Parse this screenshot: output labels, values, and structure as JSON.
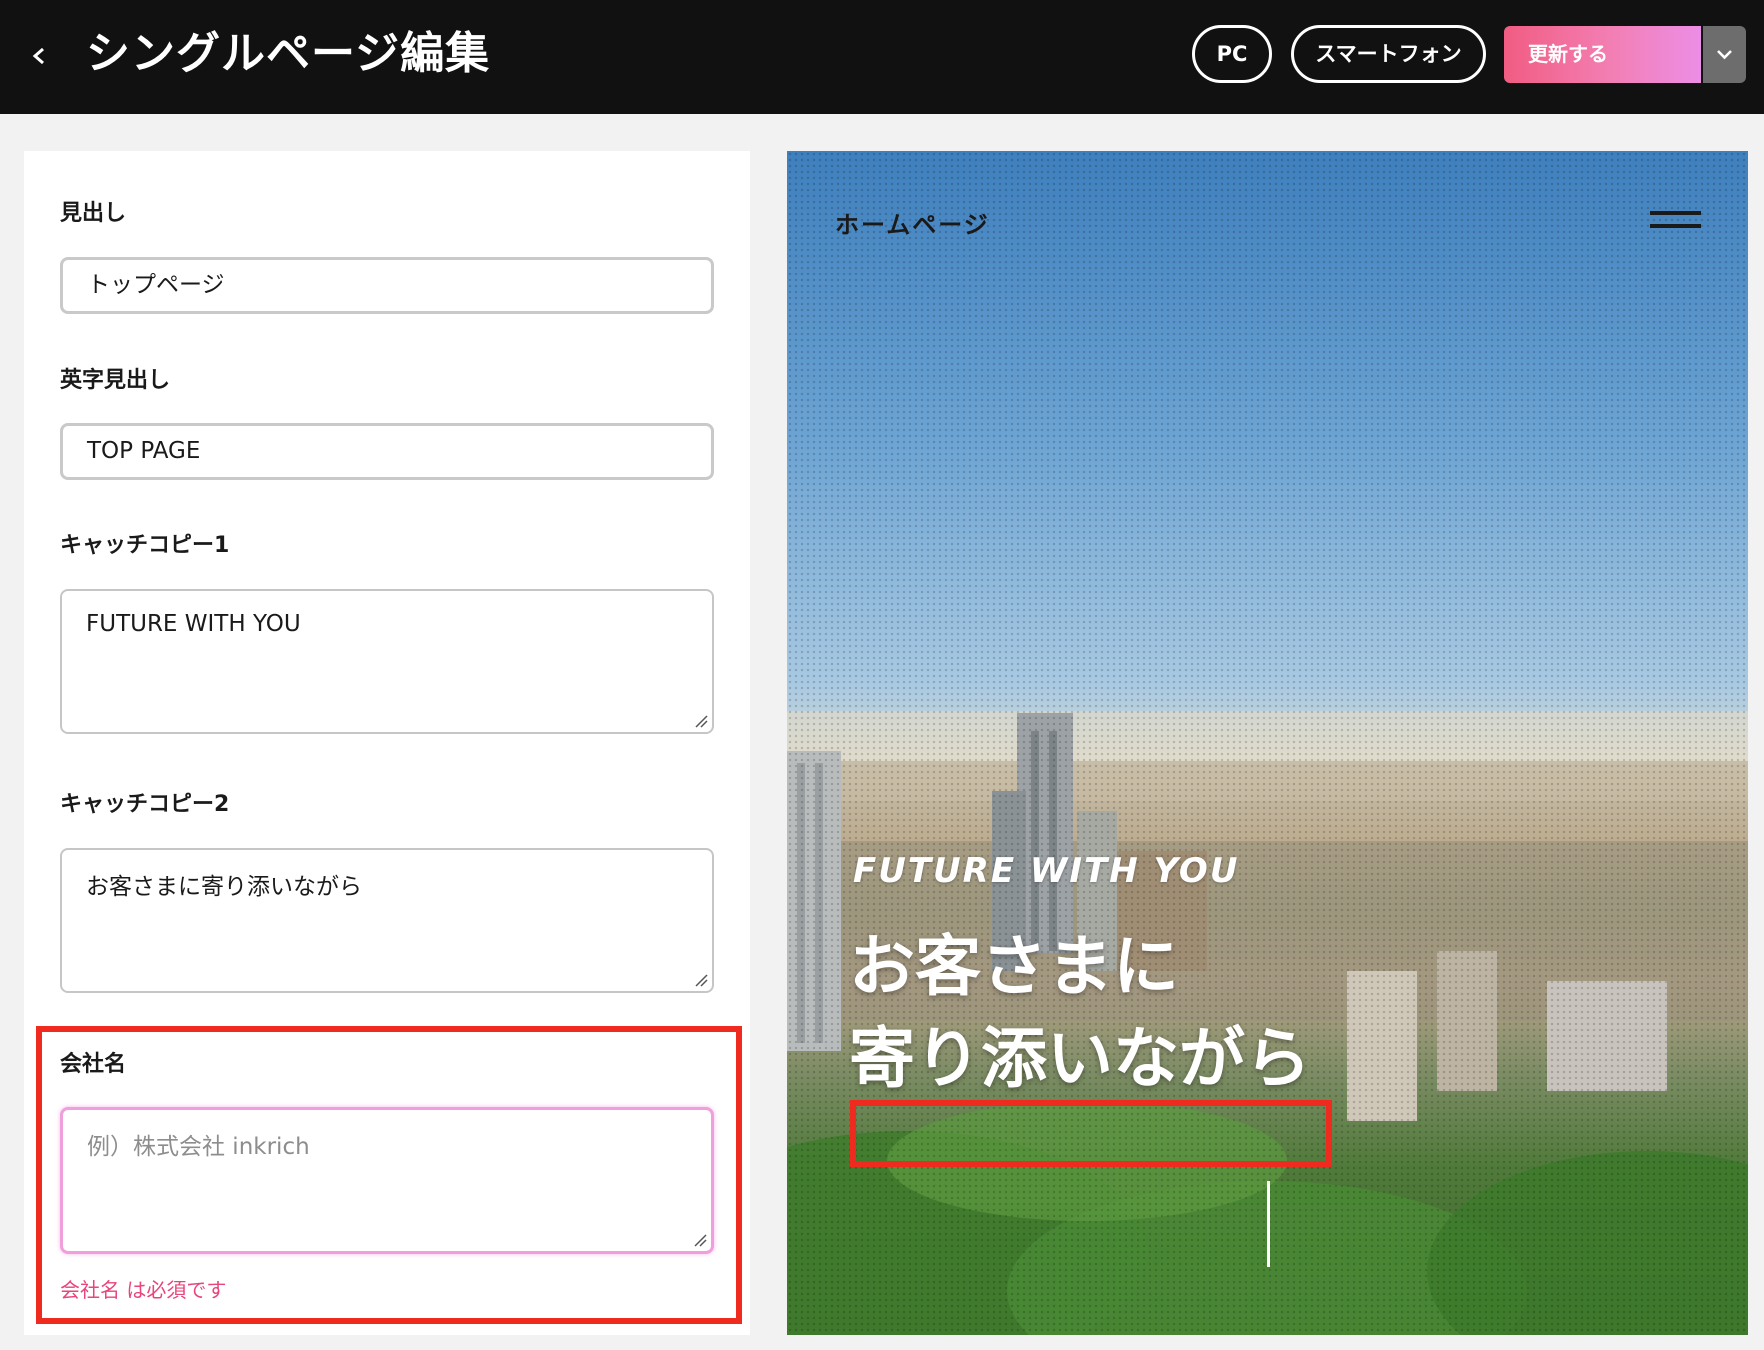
{
  "header": {
    "title": "シングルページ編集",
    "device_pc": "PC",
    "device_smartphone": "スマートフォン",
    "update_label": "更新する"
  },
  "form": {
    "heading": {
      "label": "見出し",
      "value": "トップページ"
    },
    "english_heading": {
      "label": "英字見出し",
      "value": "TOP PAGE"
    },
    "catch1": {
      "label": "キャッチコピー1",
      "value": "FUTURE WITH YOU"
    },
    "catch2": {
      "label": "キャッチコピー2",
      "value": "お客さまに寄り添いながら"
    },
    "company": {
      "label": "会社名",
      "value": "",
      "placeholder": "例）株式会社 inkrich",
      "error": "会社名 は必須です"
    }
  },
  "preview": {
    "site_title": "ホームページ",
    "catch1": "FUTURE WITH YOU",
    "catch2": "お客さまに\n寄り添いながら",
    "company": ""
  },
  "colors": {
    "topbar_bg": "#111111",
    "update_gradient_start": "#f15c82",
    "update_gradient_end": "#ec8ee6",
    "error": "#e8457a",
    "highlight": "#ef2a1f"
  },
  "icons": {
    "back": "chevron-left-icon",
    "dropdown": "chevron-down-icon",
    "menu": "hamburger-icon",
    "resize": "resize-grip-icon"
  }
}
